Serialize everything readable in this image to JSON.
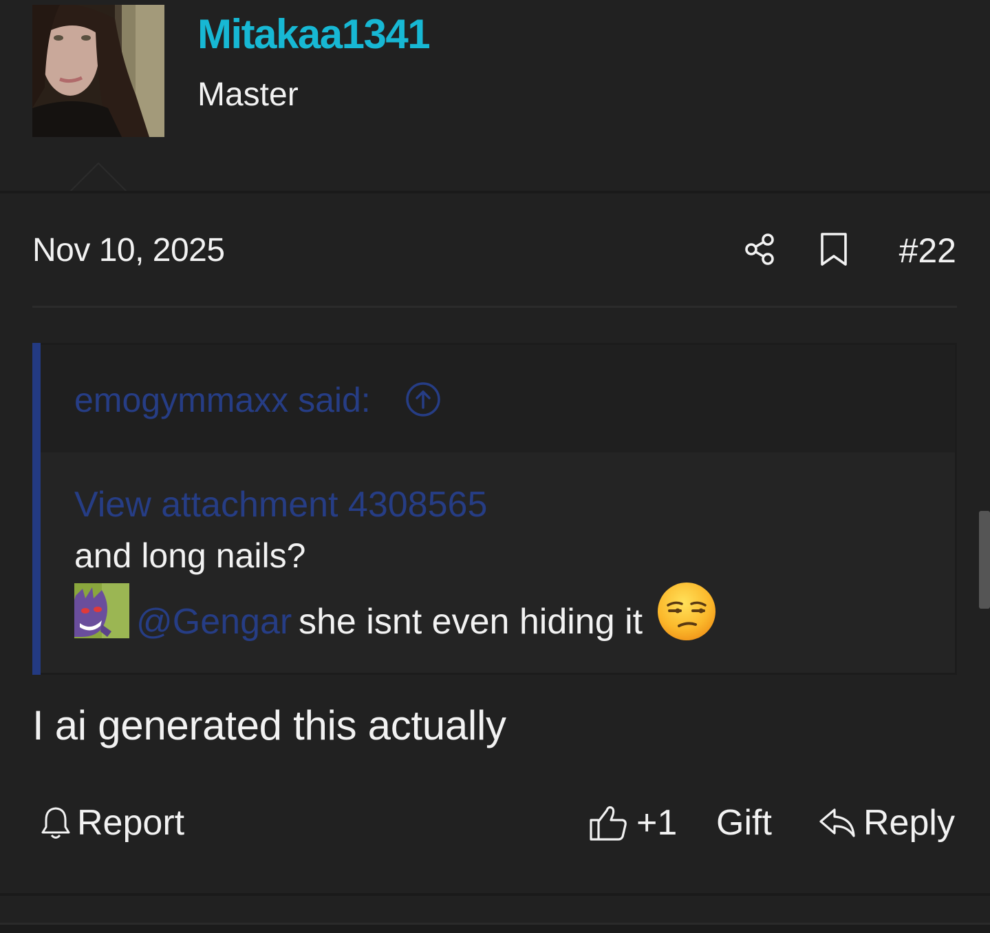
{
  "user": {
    "name": "Mitakaa1341",
    "title": "Master"
  },
  "post": {
    "date": "Nov 10, 2025",
    "number": "#22",
    "body": "I ai generated this actually"
  },
  "quote": {
    "author": "emogymmaxx said:",
    "attachment": "View attachment 4308565",
    "line1": "and long nails?",
    "mention": "@Gengar",
    "line2": "she isnt even hiding it"
  },
  "actions": {
    "report": "Report",
    "like": "+1",
    "gift": "Gift",
    "reply": "Reply"
  },
  "icons": [
    "share-icon",
    "bookmark-icon",
    "jump-to-quote-icon",
    "bell-icon",
    "thumbs-up-icon",
    "reply-arrow-icon",
    "unamused-face-emoji"
  ],
  "colors": {
    "background": "#212121",
    "username": "#17b8d4",
    "link": "#263d85",
    "quote_bar": "#233a82",
    "text": "#f2f2f2"
  }
}
